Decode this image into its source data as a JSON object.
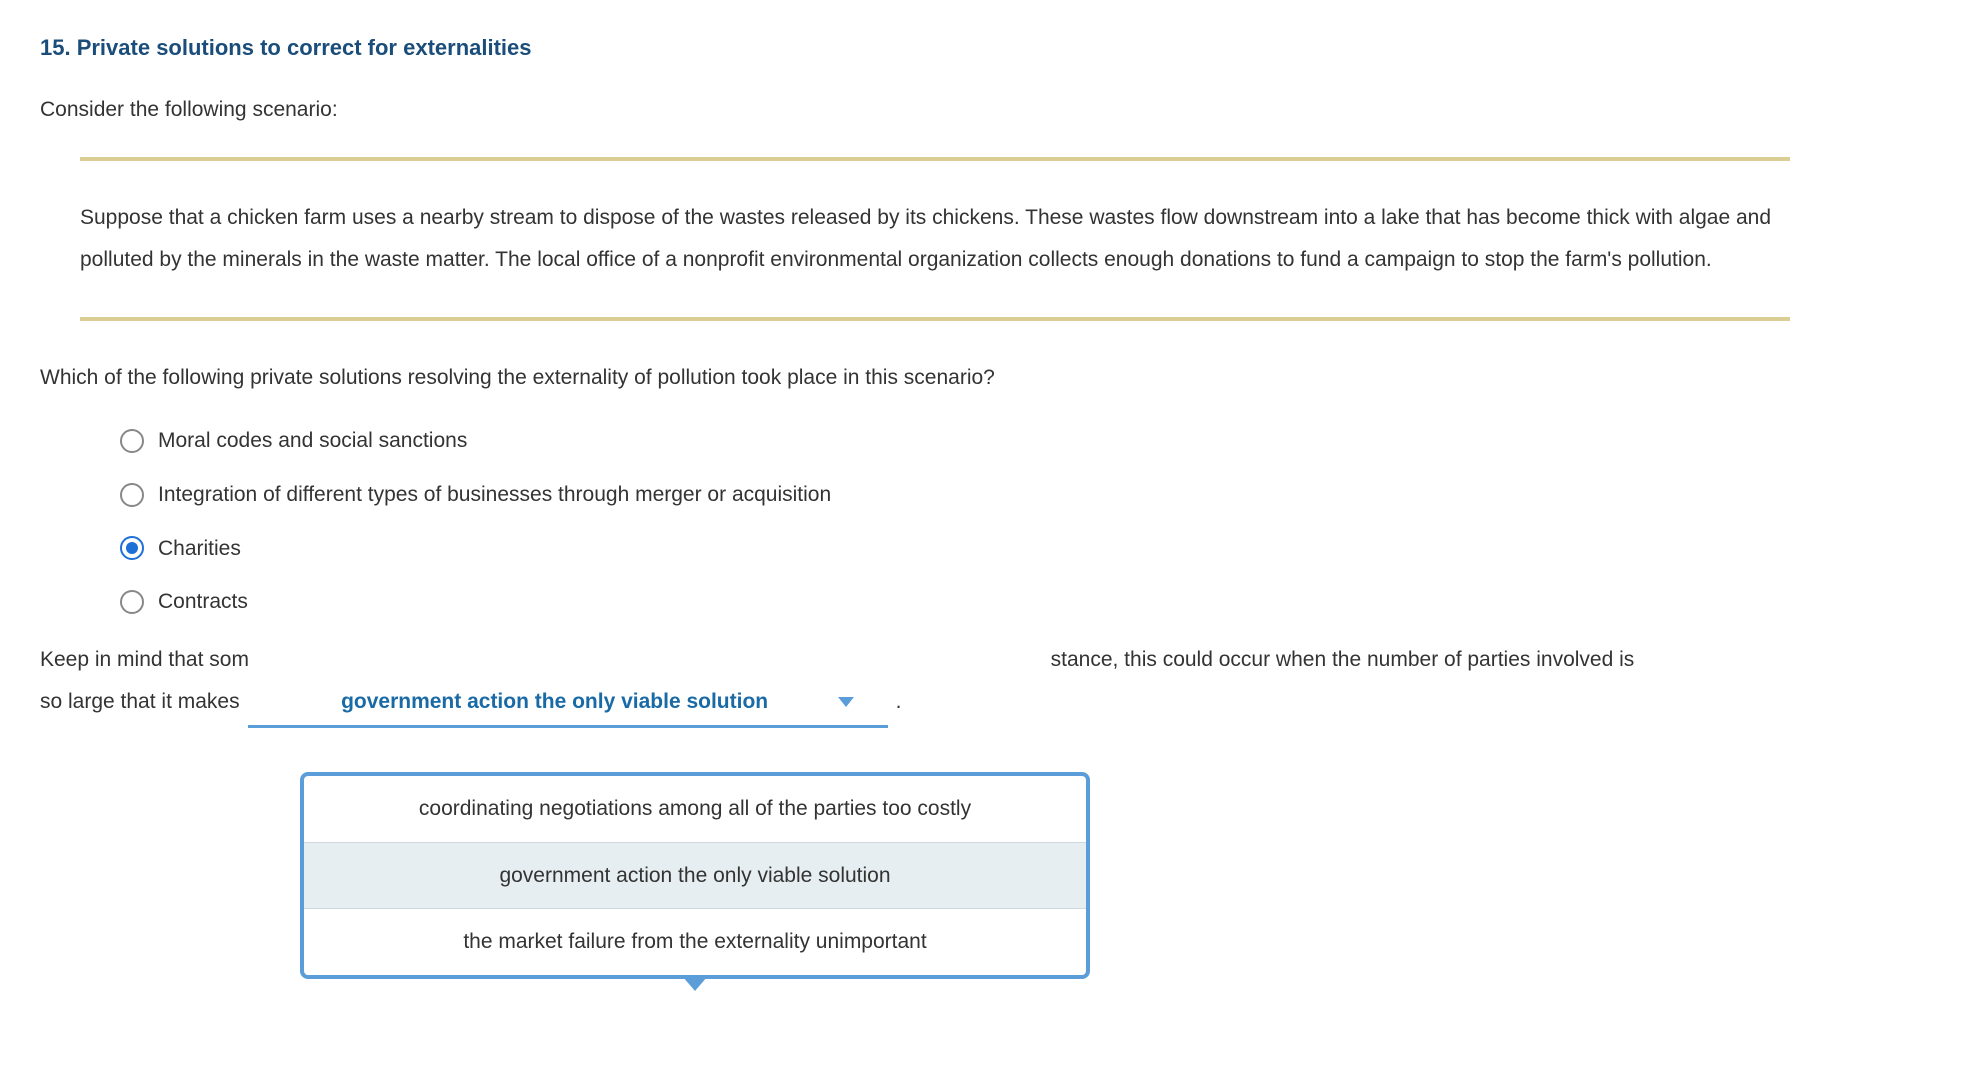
{
  "title": "15. Private solutions to correct for externalities",
  "intro": "Consider the following scenario:",
  "quote": "Suppose that a chicken farm uses a nearby stream to dispose of the wastes released by its chickens. These wastes flow downstream into a lake that has become thick with algae and polluted by the minerals in the waste matter. The local office of a nonprofit environmental organization collects enough donations to fund a campaign to stop the farm's pollution.",
  "question": "Which of the following private solutions resolving the externality of pollution took place in this scenario?",
  "options": [
    {
      "label": "Moral codes and social sanctions",
      "selected": false
    },
    {
      "label": "Integration of different types of businesses through merger or acquisition",
      "selected": false
    },
    {
      "label": "Charities",
      "selected": true
    },
    {
      "label": "Contracts",
      "selected": false
    }
  ],
  "dropdown": {
    "items": [
      "coordinating negotiations among all of the parties too costly",
      "government action the only viable solution",
      "the market failure from the externality unimportant"
    ],
    "active_index": 1,
    "selected_text": "government action the only viable solution"
  },
  "keepmind_line1_a": "Keep in mind that som",
  "keepmind_line1_b": "stance, this could occur when the number of parties involved is",
  "keepmind_line2_a": "so large that it makes",
  "keepmind_line2_period": "."
}
